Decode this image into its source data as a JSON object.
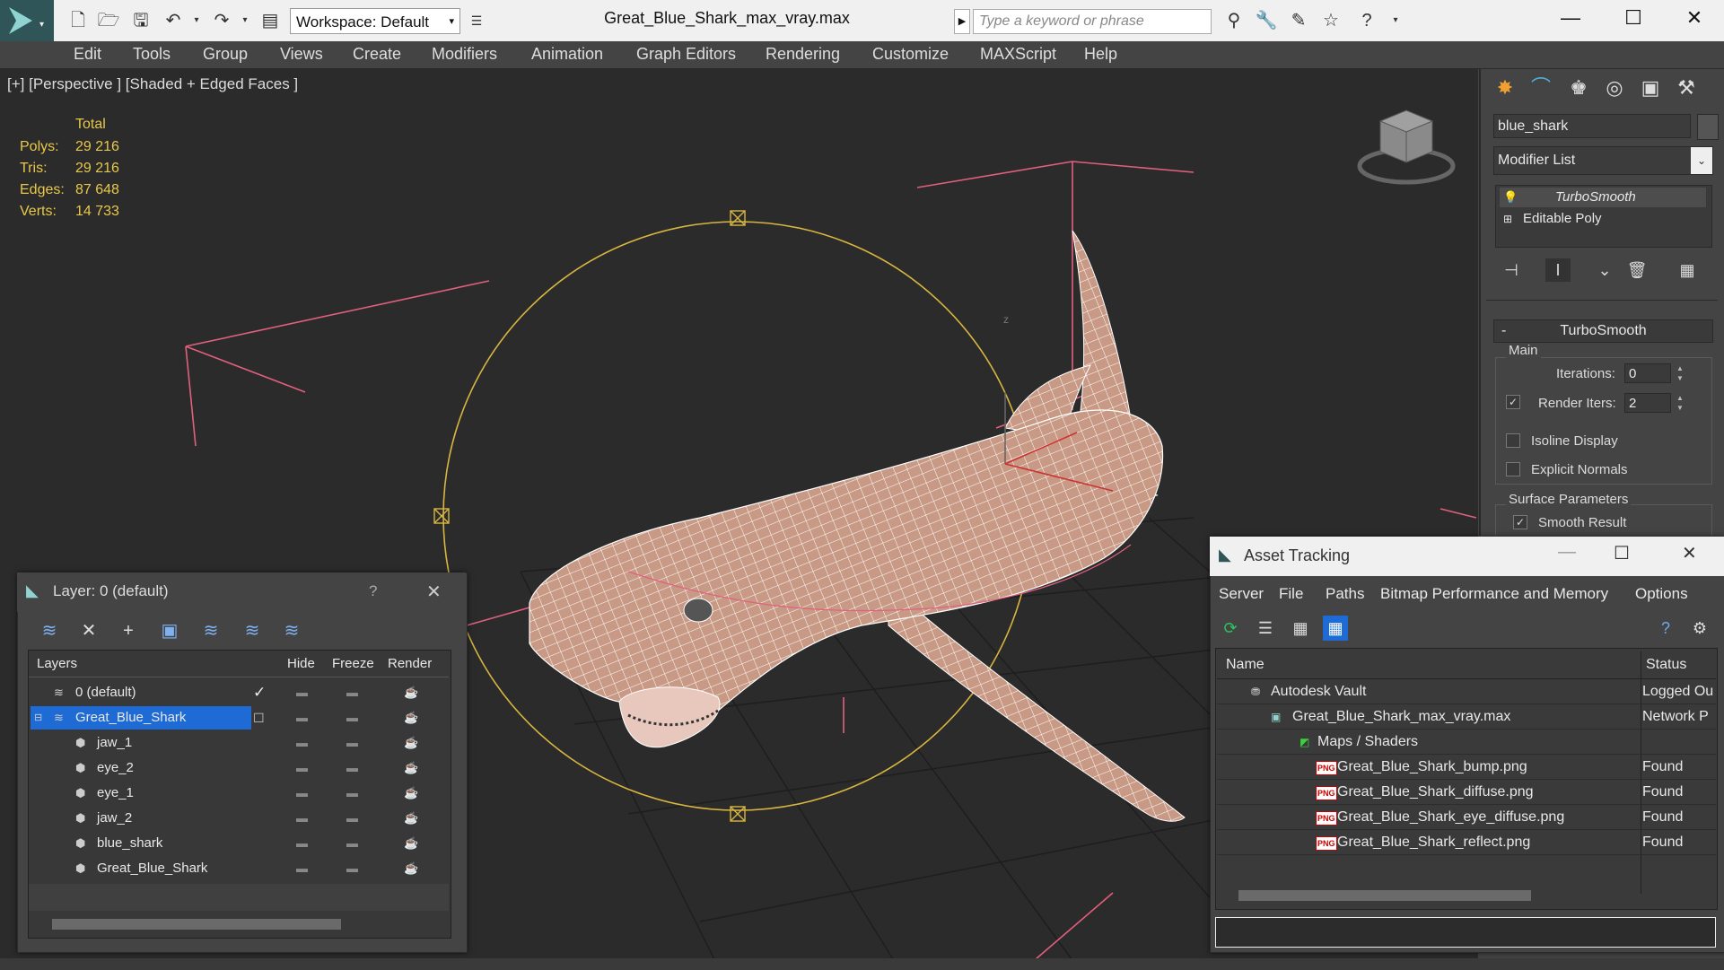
{
  "window": {
    "title": "Great_Blue_Shark_max_vray.max",
    "workspace_label": "Workspace: Default",
    "search_placeholder": "Type a keyword or phrase"
  },
  "menu": [
    "Edit",
    "Tools",
    "Group",
    "Views",
    "Create",
    "Modifiers",
    "Animation",
    "Graph Editors",
    "Rendering",
    "Customize",
    "MAXScript",
    "Help"
  ],
  "viewport": {
    "label": "[+] [Perspective ] [Shaded + Edged Faces ]",
    "stats_header": "Total",
    "stats": [
      {
        "label": "Polys:",
        "value": "29 216"
      },
      {
        "label": "Tris:",
        "value": "29 216"
      },
      {
        "label": "Edges:",
        "value": "87 648"
      },
      {
        "label": "Verts:",
        "value": "14 733"
      }
    ],
    "axis_label": "z"
  },
  "command_panel": {
    "object_name": "blue_shark",
    "modifier_list": "Modifier List",
    "stack": [
      "TurboSmooth",
      "Editable Poly"
    ],
    "rollout_title": "TurboSmooth",
    "main_group": "Main",
    "iterations_label": "Iterations:",
    "iterations_value": "0",
    "render_iters_label": "Render Iters:",
    "render_iters_value": "2",
    "isoline": "Isoline Display",
    "explicit_normals": "Explicit Normals",
    "surface_params": "Surface Parameters",
    "smooth_result": "Smooth Result"
  },
  "layer_dialog": {
    "title": "Layer: 0 (default)",
    "help": "?",
    "columns": [
      "Layers",
      "Hide",
      "Freeze",
      "Render"
    ],
    "rows": [
      {
        "name": "0 (default)",
        "indent": 1,
        "checked": true,
        "selected": false
      },
      {
        "name": "Great_Blue_Shark",
        "indent": 1,
        "checked": false,
        "selected": true
      },
      {
        "name": "jaw_1",
        "indent": 2,
        "checked": false,
        "selected": false
      },
      {
        "name": "eye_2",
        "indent": 2,
        "checked": false,
        "selected": false
      },
      {
        "name": "eye_1",
        "indent": 2,
        "checked": false,
        "selected": false
      },
      {
        "name": "jaw_2",
        "indent": 2,
        "checked": false,
        "selected": false
      },
      {
        "name": "blue_shark",
        "indent": 2,
        "checked": false,
        "selected": false
      },
      {
        "name": "Great_Blue_Shark",
        "indent": 2,
        "checked": false,
        "selected": false
      }
    ]
  },
  "asset_dialog": {
    "title": "Asset Tracking",
    "menu": [
      "Server",
      "File",
      "Paths",
      "Bitmap Performance and Memory",
      "Options"
    ],
    "columns": [
      "Name",
      "Status"
    ],
    "rows": [
      {
        "name": "Autodesk Vault",
        "status": "Logged Ou",
        "level": 1,
        "icon": "vault"
      },
      {
        "name": "Great_Blue_Shark_max_vray.max",
        "status": "Network P",
        "level": 2,
        "icon": "max"
      },
      {
        "name": "Maps / Shaders",
        "status": "",
        "level": 3,
        "icon": "maps"
      },
      {
        "name": "Great_Blue_Shark_bump.png",
        "status": "Found",
        "level": 4,
        "icon": "png"
      },
      {
        "name": "Great_Blue_Shark_diffuse.png",
        "status": "Found",
        "level": 4,
        "icon": "png"
      },
      {
        "name": "Great_Blue_Shark_eye_diffuse.png",
        "status": "Found",
        "level": 4,
        "icon": "png"
      },
      {
        "name": "Great_Blue_Shark_reflect.png",
        "status": "Found",
        "level": 4,
        "icon": "png"
      }
    ],
    "png_badge": "PNG"
  },
  "colors": {
    "accent": "#2f5559",
    "selection": "#1e6bd6",
    "stats": "#e8c84a",
    "wire": "#ffffff",
    "helper": "#e0607e",
    "circle": "#d8b640"
  }
}
